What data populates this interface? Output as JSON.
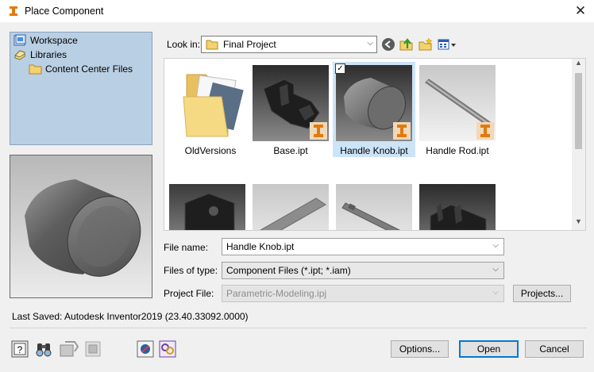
{
  "window": {
    "title": "Place Component",
    "close_glyph": "✕"
  },
  "places": [
    {
      "label": "Workspace",
      "icon": "workspace-icon"
    },
    {
      "label": "Libraries",
      "icon": "libraries-icon"
    },
    {
      "label": "Content Center Files",
      "icon": "folder-icon"
    }
  ],
  "look_in": {
    "label": "Look in:",
    "value": "Final Project"
  },
  "toolbar": {
    "back_icon": "back-icon",
    "up_icon": "up-folder-icon",
    "new_folder_icon": "new-folder-icon",
    "views_icon": "views-menu-icon"
  },
  "files": [
    {
      "name": "OldVersions",
      "kind": "folder",
      "selected": false
    },
    {
      "name": "Base.ipt",
      "kind": "part",
      "selected": false
    },
    {
      "name": "Handle Knob.ipt",
      "kind": "part",
      "selected": true
    },
    {
      "name": "Handle Rod.ipt",
      "kind": "part",
      "selected": false
    }
  ],
  "form": {
    "file_name_label": "File name:",
    "file_name_value": "Handle Knob.ipt",
    "files_of_type_label": "Files of type:",
    "files_of_type_value": "Component Files (*.ipt; *.iam)",
    "project_file_label": "Project File:",
    "project_file_value": "Parametric-Modeling.ipj",
    "projects_button": "Projects..."
  },
  "status": {
    "last_saved": "Last Saved: Autodesk Inventor2019 (23.40.33092.0000)"
  },
  "buttons": {
    "options": "Options...",
    "open": "Open",
    "cancel": "Cancel"
  },
  "bottom_toolbar": [
    "help-icon",
    "find-icon",
    "substitute-icon",
    "pattern-icon",
    "ilogic-icon",
    "interchange-icon"
  ],
  "colors": {
    "selected_tile": "#cce4f7",
    "places_bg": "#b9cfe3",
    "inventor_badge": "#e07a10",
    "default_button_border": "#0078d7"
  }
}
